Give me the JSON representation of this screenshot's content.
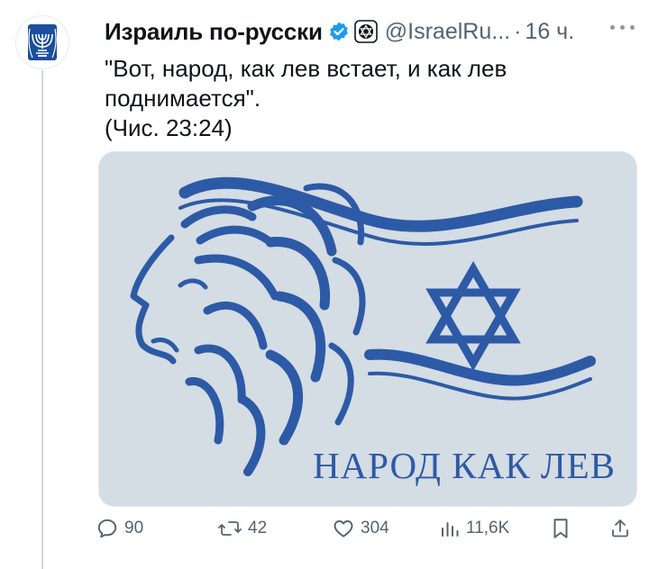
{
  "author": {
    "name": "Израиль по-русски",
    "handle": "@IsraelRu...",
    "separator": "·",
    "time": "16 ч."
  },
  "tweet": {
    "lines": [
      "\"Вот, народ, как лев встает, и как лев",
      "поднимается\".",
      "(Чис. 23:24)"
    ]
  },
  "media": {
    "caption": "НАРОД КАК ЛЕВ",
    "background": "#d4dce4",
    "ink": "#2d5aa6"
  },
  "actions": {
    "replies": "90",
    "reposts": "42",
    "likes": "304",
    "views": "11,6K"
  },
  "colors": {
    "verified": "#1d9bf0",
    "muted": "#536471",
    "text": "#0f1419"
  }
}
